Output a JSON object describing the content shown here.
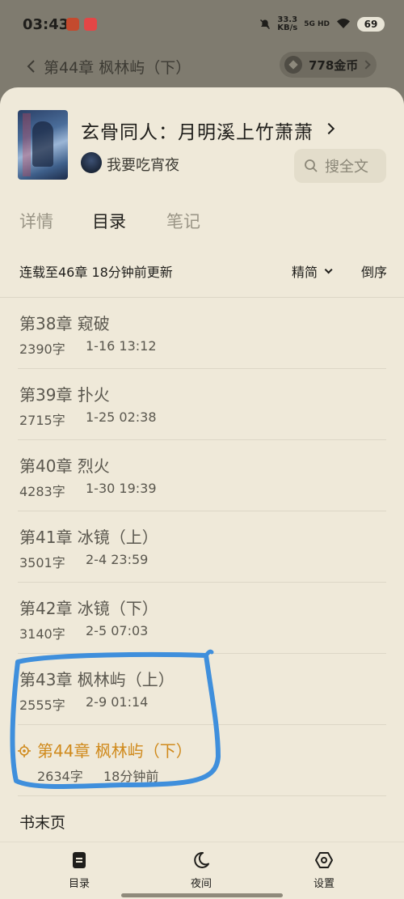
{
  "status_bar": {
    "time": "03:43",
    "net_speed_value": "33.3",
    "net_speed_unit": "KB/s",
    "signal": "5G HD",
    "battery": "69"
  },
  "reader": {
    "current_chapter_title": "第44章 枫林屿（下）",
    "coins": "778金币"
  },
  "book": {
    "title": "玄骨同人：月明溪上竹萧萧",
    "author": "我要吃宵夜",
    "search_label": "搜全文"
  },
  "tabs": [
    {
      "label": "详情"
    },
    {
      "label": "目录"
    },
    {
      "label": "笔记"
    }
  ],
  "toc": {
    "update_status": "连载至46章 18分钟前更新",
    "simplified_label": "精简",
    "reverse_label": "倒序",
    "chapters": [
      {
        "title": "第38章 窥破",
        "words": "2390字",
        "date": "1-16 13:12"
      },
      {
        "title": "第39章 扑火",
        "words": "2715字",
        "date": "1-25 02:38"
      },
      {
        "title": "第40章 烈火",
        "words": "4283字",
        "date": "1-30 19:39"
      },
      {
        "title": "第41章 冰镜（上）",
        "words": "3501字",
        "date": "2-4 23:59"
      },
      {
        "title": "第42章 冰镜（下）",
        "words": "3140字",
        "date": "2-5 07:03"
      },
      {
        "title": "第43章 枫林屿（上）",
        "words": "2555字",
        "date": "2-9 01:14"
      },
      {
        "title": "第44章 枫林屿（下）",
        "words": "2634字",
        "date": "18分钟前"
      }
    ],
    "end_page_label": "书末页"
  },
  "bottom_nav": {
    "toc_label": "目录",
    "night_label": "夜间",
    "settings_label": "设置"
  },
  "colors": {
    "sheet_bg": "#efe9d9",
    "current_chapter": "#d08a1c",
    "highlight_stroke": "#3f8fdc"
  },
  "icons": [
    "back-chevron-icon",
    "coin-icon",
    "search-icon",
    "locate-icon",
    "toc-icon",
    "moon-icon",
    "settings-icon"
  ]
}
